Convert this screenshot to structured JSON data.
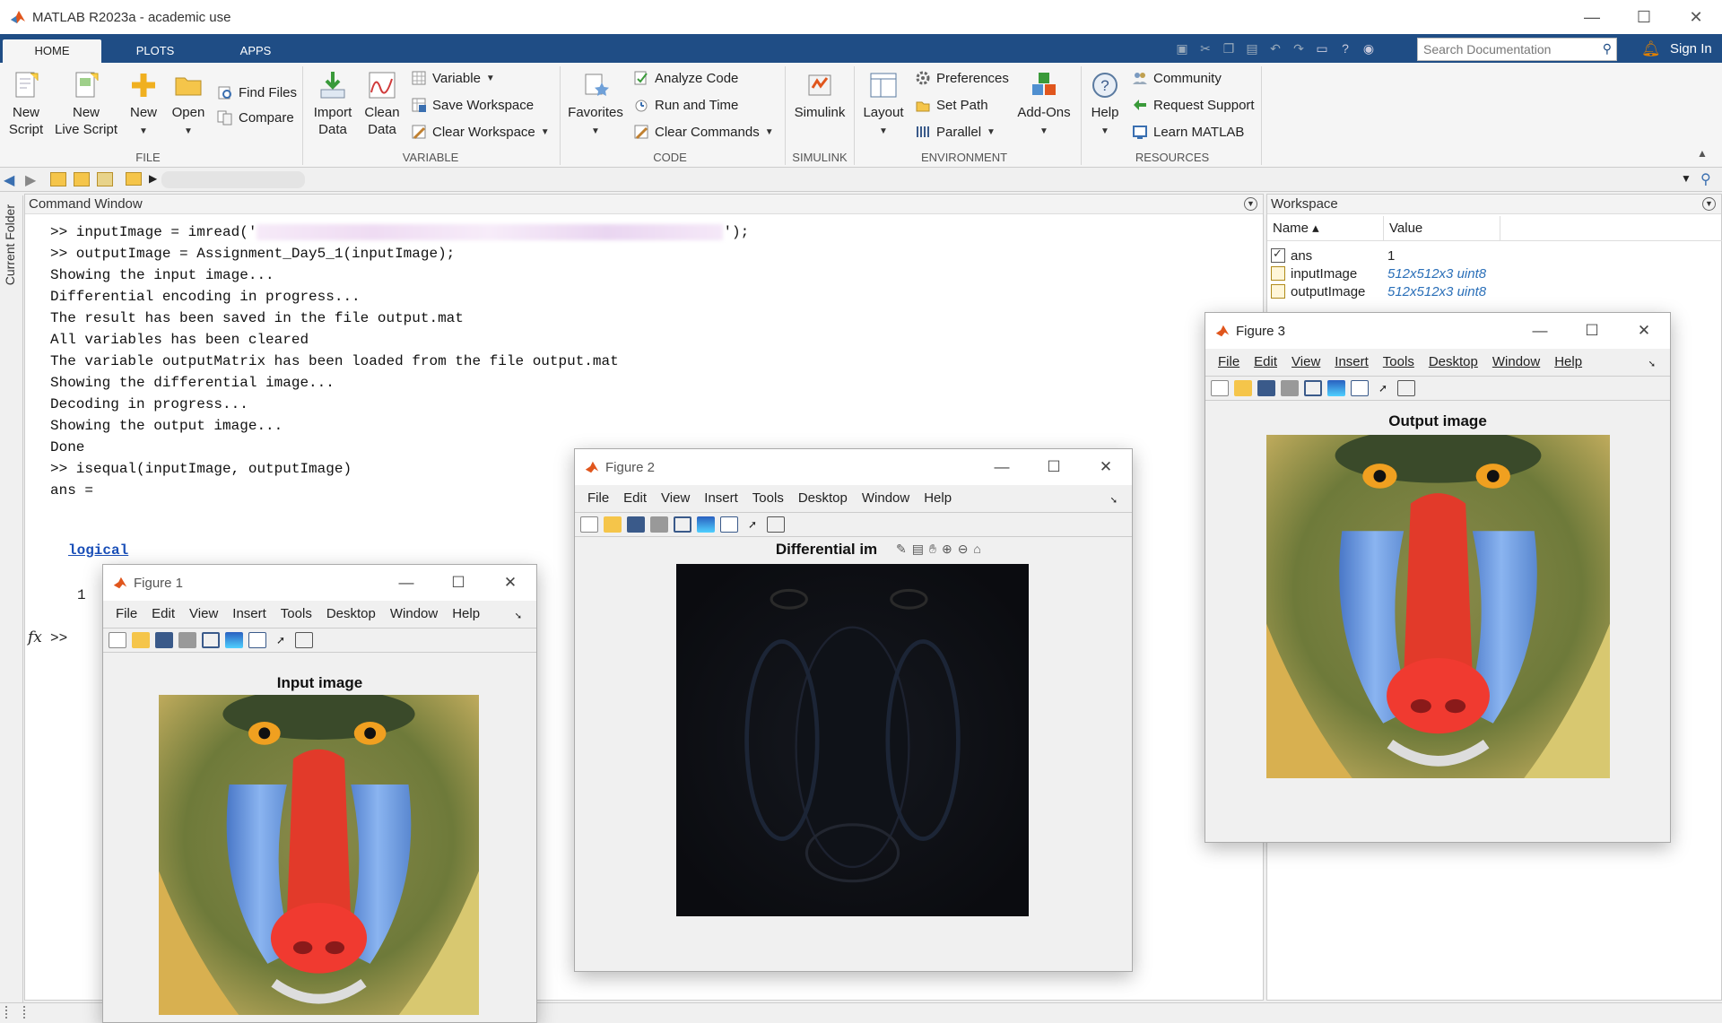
{
  "window": {
    "title": "MATLAB R2023a - academic use",
    "controls": [
      "—",
      "☐",
      "✕"
    ]
  },
  "tabs": [
    {
      "label": "HOME"
    },
    {
      "label": "PLOTS"
    },
    {
      "label": "APPS"
    }
  ],
  "search": {
    "placeholder": "Search Documentation"
  },
  "account": {
    "signin": "Sign In"
  },
  "ribbon": {
    "file": {
      "new_script": "New\nScript",
      "new_live_script": "New\nLive Script",
      "new": "New",
      "open": "Open",
      "find_files": "Find Files",
      "compare": "Compare",
      "section": "FILE"
    },
    "variable": {
      "import_data": "Import\nData",
      "clean_data": "Clean\nData",
      "variable": "Variable",
      "save_workspace": "Save Workspace",
      "clear_workspace": "Clear Workspace",
      "section": "VARIABLE"
    },
    "code": {
      "favorites": "Favorites",
      "analyze_code": "Analyze Code",
      "run_and_time": "Run and Time",
      "clear_commands": "Clear Commands",
      "section": "CODE"
    },
    "simulink": {
      "simulink": "Simulink",
      "section": "SIMULINK"
    },
    "environment": {
      "layout": "Layout",
      "preferences": "Preferences",
      "set_path": "Set Path",
      "parallel": "Parallel",
      "add_ons": "Add-Ons",
      "section": "ENVIRONMENT"
    },
    "resources": {
      "help": "Help",
      "community": "Community",
      "request_support": "Request Support",
      "learn_matlab": "Learn MATLAB",
      "section": "RESOURCES"
    }
  },
  "current_folder": {
    "label": "Current Folder"
  },
  "command_window": {
    "title": "Command Window",
    "line1_start": ">> inputImage = imread('",
    "line1_end": "');",
    "lines": [
      ">> outputImage = Assignment_Day5_1(inputImage);",
      "Showing the input image...",
      "Differential encoding in progress...",
      "The result has been saved in the file output.mat",
      "All variables has been cleared",
      "The variable outputMatrix has been loaded from the file output.mat",
      "Showing the differential image...",
      "Decoding in progress...",
      "Showing the output image...",
      "Done",
      ">> isequal(inputImage, outputImage)",
      "",
      "ans ="
    ],
    "logical": "logical",
    "result": "1",
    "fx": "fx",
    "prompt": ">>"
  },
  "workspace": {
    "title": "Workspace",
    "columns": {
      "name": "Name ▴",
      "value": "Value"
    },
    "rows": [
      {
        "name": "ans",
        "value": "1"
      },
      {
        "name": "inputImage",
        "value": "512x512x3 uint8"
      },
      {
        "name": "outputImage",
        "value": "512x512x3 uint8"
      }
    ]
  },
  "figure_menu": [
    "File",
    "Edit",
    "View",
    "Insert",
    "Tools",
    "Desktop",
    "Window",
    "Help"
  ],
  "figures": [
    {
      "title": "Figure 1",
      "axes_title": "Input image"
    },
    {
      "title": "Figure 2",
      "axes_title": "Differential im"
    },
    {
      "title": "Figure 3",
      "axes_title": "Output image"
    }
  ],
  "colors": {
    "ribbon_tab_bar": "#1f4d85",
    "workspace_value": "#2a6fb8",
    "logical_link": "#1a4fb8"
  }
}
